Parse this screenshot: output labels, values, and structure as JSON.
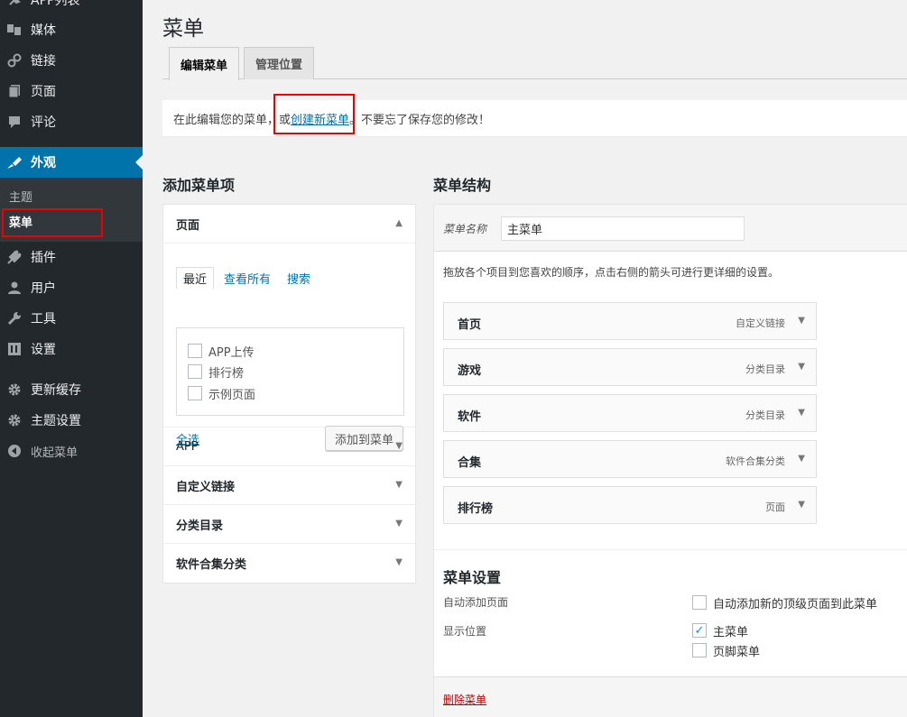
{
  "sidebar": {
    "items": [
      {
        "label": "APP列表",
        "icon": "pin-icon"
      },
      {
        "label": "媒体",
        "icon": "media-icon"
      },
      {
        "label": "链接",
        "icon": "link-icon"
      },
      {
        "label": "页面",
        "icon": "page-icon"
      },
      {
        "label": "评论",
        "icon": "comment-icon"
      },
      {
        "label": "外观",
        "icon": "appearance-icon",
        "active": true
      },
      {
        "label": "插件",
        "icon": "plugin-icon"
      },
      {
        "label": "用户",
        "icon": "user-icon"
      },
      {
        "label": "工具",
        "icon": "tool-icon"
      },
      {
        "label": "设置",
        "icon": "settings-icon"
      },
      {
        "label": "更新缓存",
        "icon": "gear-icon"
      },
      {
        "label": "主题设置",
        "icon": "gear-icon"
      },
      {
        "label": "收起菜单",
        "icon": "collapse-icon"
      }
    ],
    "submenu": [
      {
        "label": "主题"
      },
      {
        "label": "菜单",
        "current": true
      }
    ]
  },
  "page": {
    "title": "菜单",
    "tabs": [
      {
        "label": "编辑菜单",
        "active": true
      },
      {
        "label": "管理位置"
      }
    ],
    "notice": {
      "before": "在此编辑您的菜单，或",
      "link": "创建新菜单",
      "after": "。不要忘了保存您的修改！"
    }
  },
  "add_items": {
    "heading": "添加菜单项",
    "pages": {
      "title": "页面",
      "tabs": [
        "最近",
        "查看所有",
        "搜索"
      ],
      "items": [
        "APP上传",
        "排行榜",
        "示例页面"
      ],
      "select_all": "全选",
      "add_button": "添加到菜单"
    },
    "other_sections": [
      "APP",
      "自定义链接",
      "分类目录",
      "软件合集分类"
    ]
  },
  "structure": {
    "heading": "菜单结构",
    "menu_name_label": "菜单名称",
    "menu_name_value": "主菜单",
    "description": "拖放各个项目到您喜欢的顺序，点击右侧的箭头可进行更详细的设置。",
    "items": [
      {
        "title": "首页",
        "type": "自定义链接"
      },
      {
        "title": "游戏",
        "type": "分类目录"
      },
      {
        "title": "软件",
        "type": "分类目录"
      },
      {
        "title": "合集",
        "type": "软件合集分类"
      },
      {
        "title": "排行榜",
        "type": "页面"
      }
    ],
    "settings": {
      "title": "菜单设置",
      "auto_add_label": "自动添加页面",
      "auto_add_option": "自动添加新的顶级页面到此菜单",
      "location_label": "显示位置",
      "locations": [
        {
          "label": "主菜单",
          "checked": true
        },
        {
          "label": "页脚菜单",
          "checked": false
        }
      ]
    },
    "delete_link": "删除菜单"
  },
  "colors": {
    "sidebar_bg": "#23282d",
    "active_blue": "#0073aa",
    "highlight_red": "#e00000",
    "delete_red": "#aa0000"
  }
}
